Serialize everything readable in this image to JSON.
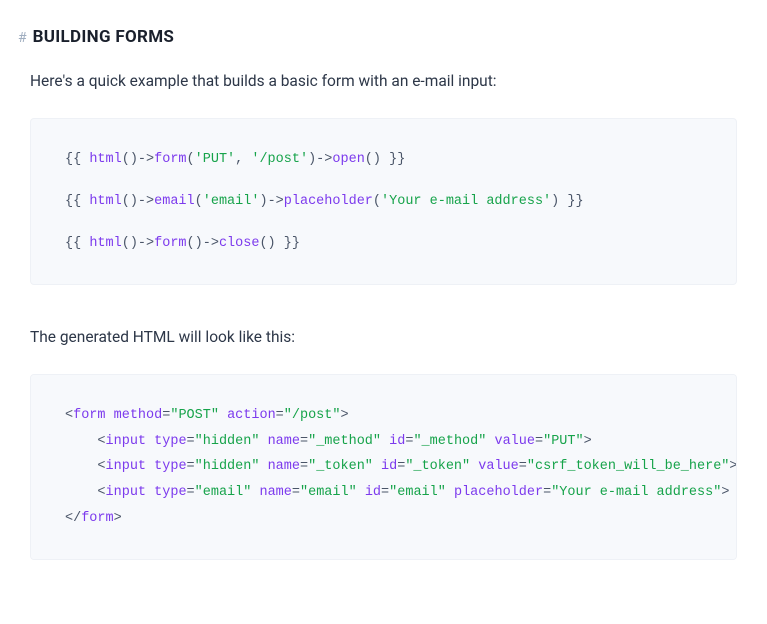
{
  "heading": {
    "anchor": "#",
    "text": "BUILDING FORMS"
  },
  "intro": "Here's a quick example that builds a basic form with an e-mail input:",
  "code1": {
    "l1": {
      "open": "{{ ",
      "fn1": "html",
      "p1": "()->",
      "fn2": "form",
      "p2": "(",
      "s1": "'PUT'",
      "c": ", ",
      "s2": "'/post'",
      "p3": ")->",
      "fn3": "open",
      "p4": "() }}"
    },
    "l2": {
      "open": "{{ ",
      "fn1": "html",
      "p1": "()->",
      "fn2": "email",
      "p2": "(",
      "s1": "'email'",
      "p3": ")->",
      "fn3": "placeholder",
      "p4": "(",
      "s2": "'Your e-mail address'",
      "p5": ") }}"
    },
    "l3": {
      "open": "{{ ",
      "fn1": "html",
      "p1": "()->",
      "fn2": "form",
      "p2": "()->",
      "fn3": "close",
      "p3": "() }}"
    }
  },
  "outro": "The generated HTML will look like this:",
  "code2": {
    "l1": {
      "o": "<",
      "tag": "form",
      "sp": " ",
      "a1": "method",
      "e1": "=",
      "v1": "\"POST\"",
      "sp2": " ",
      "a2": "action",
      "e2": "=",
      "v2": "\"/post\"",
      "c": ">"
    },
    "l2": {
      "ind": "    ",
      "o": "<",
      "tag": "input",
      "sp": " ",
      "a1": "type",
      "e1": "=",
      "v1": "\"hidden\"",
      "sp2": " ",
      "a2": "name",
      "e2": "=",
      "v2": "\"_method\"",
      "sp3": " ",
      "a3": "id",
      "e3": "=",
      "v3": "\"_method\"",
      "sp4": " ",
      "a4": "value",
      "e4": "=",
      "v4": "\"PUT\"",
      "c": ">"
    },
    "l3": {
      "ind": "    ",
      "o": "<",
      "tag": "input",
      "sp": " ",
      "a1": "type",
      "e1": "=",
      "v1": "\"hidden\"",
      "sp2": " ",
      "a2": "name",
      "e2": "=",
      "v2": "\"_token\"",
      "sp3": " ",
      "a3": "id",
      "e3": "=",
      "v3": "\"_token\"",
      "sp4": " ",
      "a4": "value",
      "e4": "=",
      "v4": "\"csrf_token_will_be_here\"",
      "c": ">"
    },
    "l4": {
      "ind": "    ",
      "o": "<",
      "tag": "input",
      "sp": " ",
      "a1": "type",
      "e1": "=",
      "v1": "\"email\"",
      "sp2": " ",
      "a2": "name",
      "e2": "=",
      "v2": "\"email\"",
      "sp3": " ",
      "a3": "id",
      "e3": "=",
      "v3": "\"email\"",
      "sp4": " ",
      "a4": "placeholder",
      "e4": "=",
      "v4": "\"Your e-mail address\"",
      "c": ">"
    },
    "l5": {
      "o": "</",
      "tag": "form",
      "c": ">"
    }
  }
}
